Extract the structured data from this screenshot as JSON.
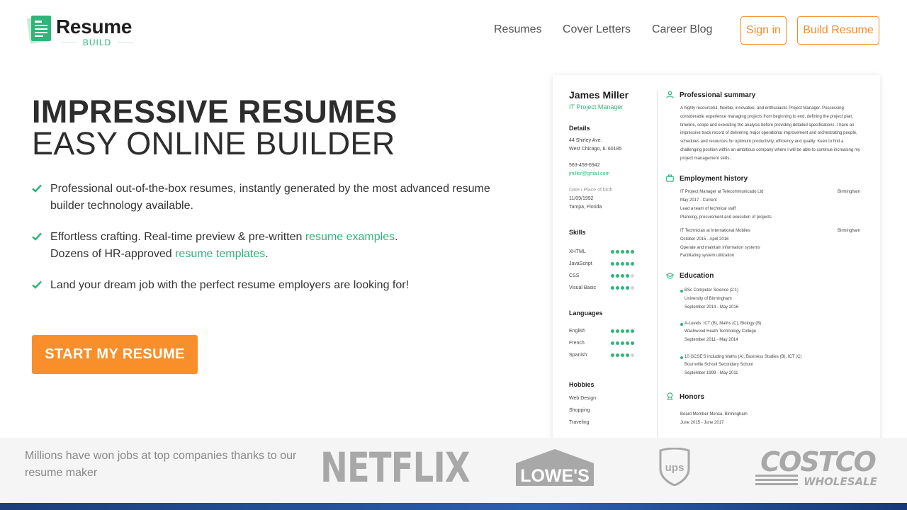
{
  "brand": {
    "name": "Resume",
    "sub": "BUILD"
  },
  "nav": {
    "resumes": "Resumes",
    "cover_letters": "Cover Letters",
    "career_blog": "Career Blog"
  },
  "auth": {
    "sign_in": "Sign in",
    "build_resume": "Build Resume"
  },
  "hero": {
    "title_bold": "IMPRESSIVE RESUMES",
    "title_light": "EASY ONLINE BUILDER",
    "f1": "Professional out-of-the-box resumes, instantly generated by the most advanced resume builder technology available.",
    "f2_a": "Effortless crafting. Real-time preview & pre-written ",
    "f2_link1": "resume examples",
    "f2_b": ".",
    "f2_c": "Dozens of HR-approved ",
    "f2_link2": "resume templates",
    "f2_d": ".",
    "f3": "Land your dream job with the perfect resume employers are looking for!",
    "cta": "START MY RESUME"
  },
  "resume": {
    "name": "James Miller",
    "role": "IT Project Manager",
    "details_h": "Details",
    "addr1": "44 Shirley Ave.",
    "addr2": "West Chicago, IL 60185",
    "phone": "563-458-6942",
    "email": "jmiller@gmail.com",
    "dob_label": "Date / Place of birth",
    "dob": "11/09/1992",
    "pob": "Tampa, Florida",
    "skills_h": "Skills",
    "skills": [
      {
        "name": "XHTML",
        "level": 5
      },
      {
        "name": "JavaScript",
        "level": 5
      },
      {
        "name": "CSS",
        "level": 4
      },
      {
        "name": "Visual Basic",
        "level": 4
      }
    ],
    "languages_h": "Languages",
    "languages": [
      {
        "name": "English",
        "level": 5
      },
      {
        "name": "French",
        "level": 5
      },
      {
        "name": "Spanish",
        "level": 4
      }
    ],
    "hobbies_h": "Hobbies",
    "hobbies": [
      "Web Design",
      "Shopping",
      "Traveling"
    ],
    "summary_h": "Professional summary",
    "summary": "A highly resourceful, flexible, innovative, and enthusiastic Project Manager. Possessing considerable experience managing projects from beginning to end, defining the project plan, timeline, scope and executing the analysis before providing detailed specifications. I have an impressive track record of delivering major operational improvement and orchestrating people, schedules and resources for optimum productivity, efficiency and quality. Keen to find a challenging position within an ambitious company where I will be able to continue increasing my project management skills.",
    "employment_h": "Employment history",
    "jobs": [
      {
        "title": "IT Project Manager at Telecommunicado Ltd",
        "city": "Birmingham",
        "dates": "May 2017 - Current",
        "l1": "Lead a team of technical staff",
        "l2": "Planning, procurement and execution of projects"
      },
      {
        "title": "IT Technician at International Mobiles",
        "city": "Birmingham",
        "dates": "October 2015 - April 2016",
        "l1": "Operate and maintain information systems",
        "l2": "Facilitating system utilization"
      }
    ],
    "education_h": "Education",
    "education": [
      {
        "l1": "BSc Computer Science (2:1)",
        "l2": "University of Birmingham",
        "l3": "September 2014 - May 2016"
      },
      {
        "l1": "A-Levels: ICT (B), Maths (C), Biology (B)",
        "l2": "Washwood Heath Technology College",
        "l3": "September 2011 - May 2014"
      },
      {
        "l1": "10 GCSE'S including Maths (A), Business Studies (B), ICT (C)",
        "l2": "Bournville School Secondary School",
        "l3": "September 1999 - May 2011"
      }
    ],
    "honors_h": "Honors",
    "honors_l1": "Board Member Mensa, Birmingham",
    "honors_l2": "June 2015 - June 2017"
  },
  "strip": {
    "text": "Millions have won jobs at top companies thanks to our resume maker",
    "netflix": "NETFLIX",
    "lowes": "LOWE'S",
    "ups": "ups",
    "costco": "COSTCO",
    "costco_sub": "WHOLESALE"
  },
  "colors": {
    "accent": "#f98f2b",
    "green": "#2fb57a",
    "text": "#2d2d2d"
  }
}
